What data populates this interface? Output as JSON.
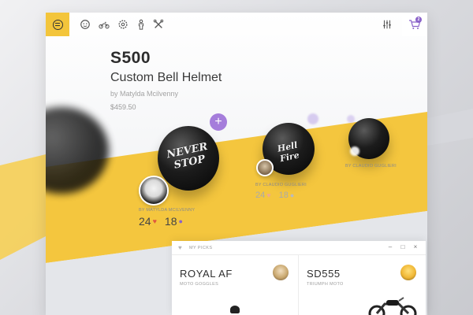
{
  "toolbar": {
    "icons": [
      "menu-icon",
      "face-icon",
      "motorcycle-icon",
      "settings-icon",
      "person-icon",
      "tools-icon",
      "filters-icon",
      "cart-icon"
    ],
    "cart_count": "2"
  },
  "product": {
    "code": "S500",
    "name": "Custom Bell Helmet",
    "author": "by Matylda Mcilvenny",
    "price": "$459.50"
  },
  "helmets": [
    {
      "art_text": "NEVER STOP",
      "creator": "BY MATYLDA MCILVENNY",
      "likes": "24",
      "comments": "18"
    },
    {
      "art_text": "Hell Fire",
      "creator": "BY CLAUDIO GUGLIERI",
      "likes": "24",
      "comments": "18"
    },
    {
      "art_text": "",
      "creator": "BY CLAUDIO GUGLIERI"
    }
  ],
  "picks": {
    "title": "MY PICKS",
    "items": [
      {
        "name": "ROYAL AF",
        "subtitle": "MOTO GOGGLES"
      },
      {
        "name": "SD555",
        "subtitle": "TRIUMPH MOTO"
      }
    ]
  },
  "colors": {
    "accent_yellow": "#f3c53b",
    "accent_purple": "#a57ddb",
    "heart_red": "#e0573e"
  }
}
